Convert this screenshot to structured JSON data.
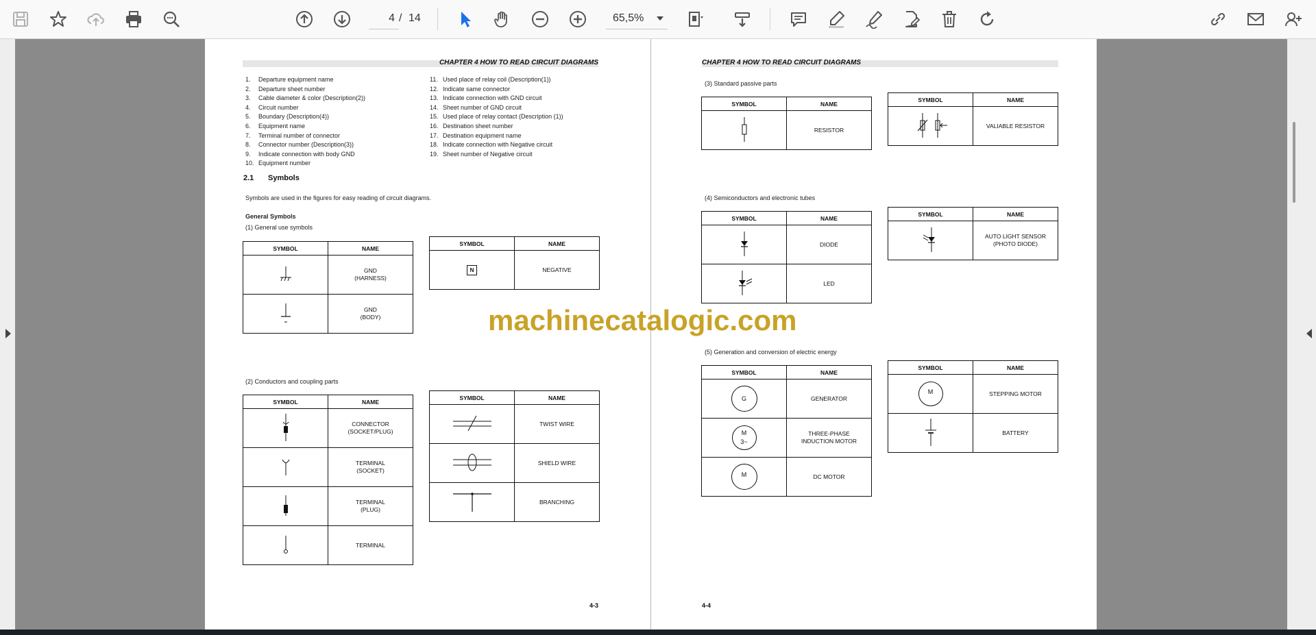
{
  "toolbar": {
    "page_current": "4",
    "page_separator": "/",
    "page_total": "14",
    "zoom": "65,5%",
    "icons": [
      "save-icon",
      "star-icon",
      "cloud-upload-icon",
      "print-icon",
      "zoom-search-icon",
      "page-up-icon",
      "page-down-icon",
      "selection-cursor-icon",
      "hand-icon",
      "zoom-out-icon",
      "zoom-in-icon",
      "fit-page-icon",
      "scroll-mode-icon",
      "comment-icon",
      "highlight-pen-icon",
      "draw-signature-icon",
      "edit-pdf-icon",
      "delete-icon",
      "rotate-icon",
      "share-link-icon",
      "email-icon",
      "add-user-icon"
    ],
    "accent_color": "#1a73e8"
  },
  "watermark": "machinecatalogic.com",
  "left_page": {
    "chapter_title": "CHAPTER 4 HOW TO READ CIRCUIT DIAGRAMS",
    "list_col1": [
      {
        "n": "1.",
        "t": "Departure equipment name"
      },
      {
        "n": "2.",
        "t": "Departure sheet number"
      },
      {
        "n": "3.",
        "t": "Cable diameter & color (Description(2))"
      },
      {
        "n": "4.",
        "t": "Circuit number"
      },
      {
        "n": "5.",
        "t": "Boundary (Description(4))"
      },
      {
        "n": "6.",
        "t": "Equipment name"
      },
      {
        "n": "7.",
        "t": "Terminal number of connector"
      },
      {
        "n": "8.",
        "t": "Connector number (Description(3))"
      },
      {
        "n": "9.",
        "t": "Indicate connection with body GND"
      },
      {
        "n": "10.",
        "t": "Equipment number"
      }
    ],
    "list_col2": [
      {
        "n": "11.",
        "t": "Used place of relay coil (Description(1))"
      },
      {
        "n": "12.",
        "t": "Indicate same connector"
      },
      {
        "n": "13.",
        "t": "Indicate connection with GND circuit"
      },
      {
        "n": "14.",
        "t": "Sheet number of GND circuit"
      },
      {
        "n": "15.",
        "t": "Used place of relay contact (Description (1))"
      },
      {
        "n": "16.",
        "t": "Destination sheet number"
      },
      {
        "n": "17.",
        "t": "Destination equipment name"
      },
      {
        "n": "18.",
        "t": "Indicate connection with Negative circuit"
      },
      {
        "n": "19.",
        "t": "Sheet number of Negative circuit"
      }
    ],
    "section_number": "2.1",
    "section_title": "Symbols",
    "intro": "Symbols are used in the figures for easy reading of circuit diagrams.",
    "general_symbols": "General Symbols",
    "sub1": "(1)   General use symbols",
    "sub2": "(2)   Conductors and coupling parts",
    "col_symbol": "SYMBOL",
    "col_name": "NAME",
    "t1": [
      {
        "l1": "GND",
        "l2": "(HARNESS)"
      },
      {
        "l1": "GND",
        "l2": "(BODY)"
      }
    ],
    "t2": [
      {
        "l1": "NEGATIVE",
        "l2": ""
      }
    ],
    "t3": [
      {
        "l1": "CONNECTOR",
        "l2": "(SOCKET/PLUG)"
      },
      {
        "l1": "TERMINAL",
        "l2": "(SOCKET)"
      },
      {
        "l1": "TERMINAL",
        "l2": "(PLUG)"
      },
      {
        "l1": "TERMINAL",
        "l2": ""
      }
    ],
    "t4": [
      {
        "l1": "TWIST WIRE",
        "l2": ""
      },
      {
        "l1": "SHIELD WIRE",
        "l2": ""
      },
      {
        "l1": "BRANCHING",
        "l2": ""
      }
    ],
    "negative_symbol_letter": "N",
    "page_number": "4-3"
  },
  "right_page": {
    "chapter_title": "CHAPTER 4 HOW TO READ CIRCUIT DIAGRAMS",
    "sub3": "(3)   Standard passive parts",
    "sub4": "(4)   Semiconductors and electronic tubes",
    "sub5": "(5)   Generation and conversion of electric energy",
    "col_symbol": "SYMBOL",
    "col_name": "NAME",
    "t5": [
      {
        "l1": "RESISTOR",
        "l2": ""
      }
    ],
    "t6": [
      {
        "l1": "VALIABLE RESISTOR",
        "l2": ""
      }
    ],
    "t7": [
      {
        "l1": "DIODE",
        "l2": ""
      },
      {
        "l1": "LED",
        "l2": ""
      }
    ],
    "t8": [
      {
        "l1": "AUTO LIGHT SENSOR",
        "l2": "(PHOTO DIODE)"
      }
    ],
    "t9": [
      {
        "l1": "GENERATOR",
        "l2": ""
      },
      {
        "l1": "THREE-PHASE",
        "l2": "INDUCTION MOTOR"
      },
      {
        "l1": "DC MOTOR",
        "l2": ""
      }
    ],
    "t10": [
      {
        "l1": "STEPPING MOTOR",
        "l2": ""
      },
      {
        "l1": "BATTERY",
        "l2": ""
      }
    ],
    "gen_letter": "G",
    "motor_letter": "M",
    "three_phase_label": "3~",
    "page_number": "4-4"
  }
}
